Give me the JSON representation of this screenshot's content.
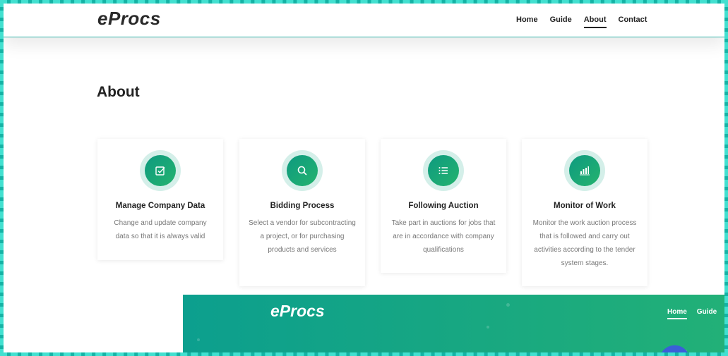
{
  "header": {
    "brand": "eProcs",
    "nav": [
      {
        "label": "Home",
        "active": false
      },
      {
        "label": "Guide",
        "active": false
      },
      {
        "label": "About",
        "active": true
      },
      {
        "label": "Contact",
        "active": false
      }
    ]
  },
  "about": {
    "title": "About",
    "cards": [
      {
        "icon": "checkbox-icon",
        "title": "Manage Company Data",
        "text": "Change and update company data so that it is always valid"
      },
      {
        "icon": "search-icon",
        "title": "Bidding Process",
        "text": "Select a vendor for subcontracting a project, or for purchasing products and services"
      },
      {
        "icon": "list-icon",
        "title": "Following Auction",
        "text": "Take part in auctions for jobs that are in accordance with company qualifications"
      },
      {
        "icon": "bar-chart-icon",
        "title": "Monitor of Work",
        "text": "Monitor the work auction process that is followed and carry out activities according to the tender system stages."
      }
    ]
  },
  "preview": {
    "brand": "eProcs",
    "nav": [
      {
        "label": "Home",
        "active": true
      },
      {
        "label": "Guide",
        "active": false
      }
    ]
  },
  "colors": {
    "accent": "#16a683",
    "frame": "#14b3a5"
  }
}
